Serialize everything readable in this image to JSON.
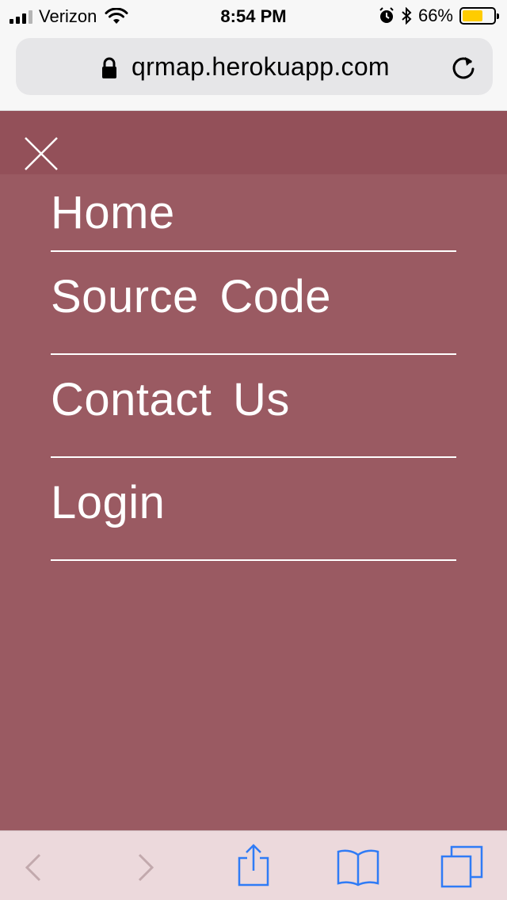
{
  "status_bar": {
    "carrier": "Verizon",
    "time": "8:54 PM",
    "battery_percent": "66%",
    "battery_level": 0.66,
    "signal_bars": 3,
    "icons": [
      "signal-icon",
      "wifi-icon",
      "alarm-icon",
      "bluetooth-icon",
      "battery-icon"
    ]
  },
  "browser": {
    "url": "qrmap.herokuapp.com",
    "icons": [
      "lock-icon",
      "reload-icon"
    ]
  },
  "menu": {
    "close_icon": "close-icon",
    "items": [
      {
        "label": "Home"
      },
      {
        "label": "Source Code"
      },
      {
        "label": "Contact Us"
      },
      {
        "label": "Login"
      }
    ]
  },
  "toolbar": {
    "icons": [
      "back-icon",
      "forward-icon",
      "share-icon",
      "bookmarks-icon",
      "tabs-icon"
    ]
  },
  "colors": {
    "menu_background": "#9a5a62",
    "menu_header": "#935059",
    "toolbar_background": "#ecd9dc",
    "ios_blue": "#2f7bf6",
    "battery_fill": "#ffcc00"
  }
}
